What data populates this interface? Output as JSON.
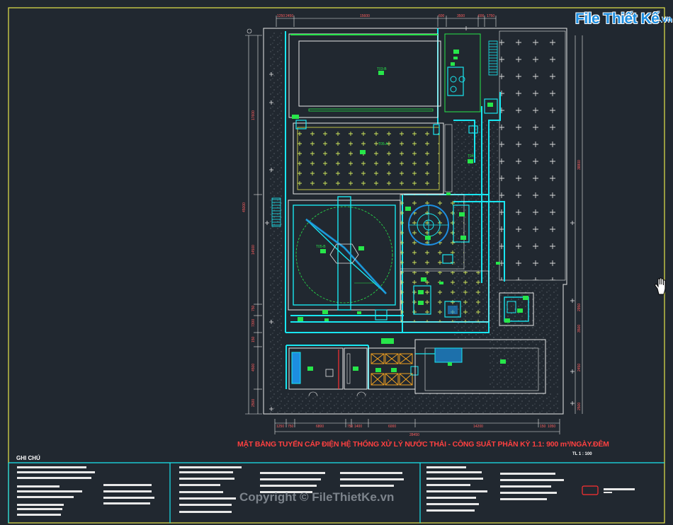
{
  "logo": {
    "brand": "File Thiết Kế",
    "tld": ".vn"
  },
  "drawing": {
    "title": "MẶT BẰNG TUYẾN CÁP ĐIỆN HỆ THỐNG XỬ LÝ NƯỚC THẢI - CÔNG SUẤT PHÂN KỲ 1.1: 900 m³/NGÀY.ĐÊM",
    "scale": "TL 1 : 100"
  },
  "notes": {
    "title": "GHI CHÚ"
  },
  "watermark": "Copyright © FileThietKe.vn",
  "tanks": [
    "T03-B",
    "T05-A",
    "T05-B",
    "T05-A",
    "T04",
    "T02",
    "T03-A",
    "T03-B",
    "T01",
    "N01",
    "N02",
    "N03",
    "N04",
    "T07",
    "T06"
  ],
  "dimensions": {
    "top": [
      "1250",
      "2450",
      "15600",
      "600",
      "3500",
      "600",
      "1750"
    ],
    "bottom": [
      "1250",
      "750",
      "6800",
      "750",
      "14500",
      "1400",
      "6000",
      "14200",
      "150",
      "1050",
      "28450"
    ],
    "left": [
      "17600",
      "45000",
      "14500",
      "750",
      "7300",
      "150",
      "4500",
      "2500"
    ],
    "right": [
      "38800",
      "39550",
      "2950",
      "3500",
      "27600",
      "2450",
      "2500"
    ]
  },
  "colors": {
    "background": "#212830",
    "frame": "#e6e64a",
    "pipe": "#19e6f0",
    "equipment": "#27e64a",
    "outline": "#e8e8e8",
    "title": "#ff4040",
    "pump_housing": "#f0a020"
  }
}
